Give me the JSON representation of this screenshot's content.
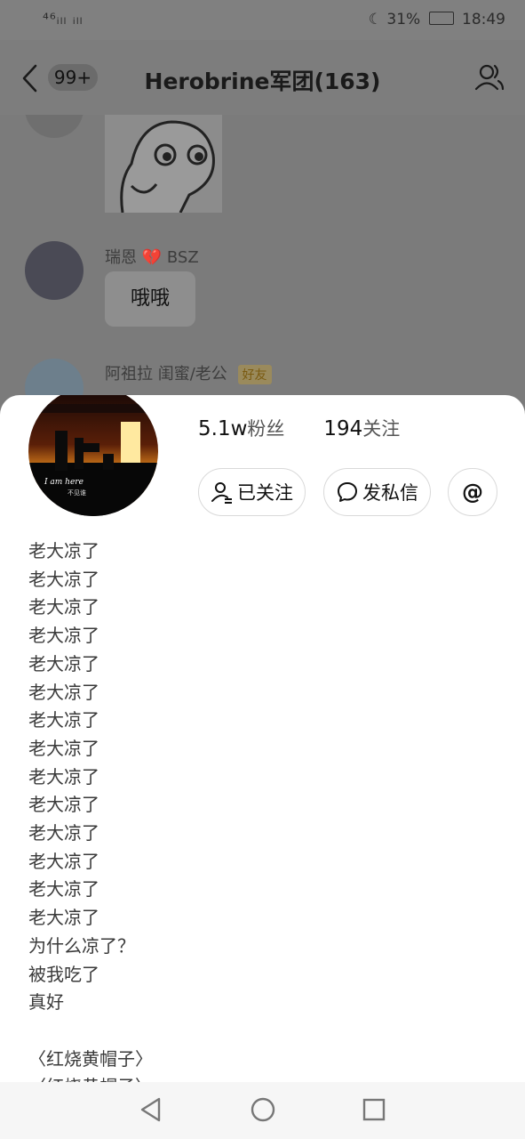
{
  "status_bar": {
    "left": "⁴⁶ᵢₗₗ ᵢₗₗ",
    "battery": "31%",
    "time": "18:49"
  },
  "header": {
    "unread_badge": "99+",
    "title": "Herobrine军团(163)"
  },
  "chat": {
    "messages": [
      {
        "sender": "瑞恩",
        "sender_tag": "BSZ",
        "text": "哦哦"
      },
      {
        "sender": "阿祖拉 闺蜜/老公",
        "badge": "好友"
      }
    ]
  },
  "profile": {
    "avatar_text_1": "I am here",
    "avatar_text_2": "不见谁",
    "fans_count": "5.1w",
    "fans_label": "粉丝",
    "following_count": "194",
    "following_label": "关注",
    "follow_button": "已关注",
    "message_button": "发私信",
    "mention_button": "@",
    "bio": "老大凉了\n老大凉了\n老大凉了\n老大凉了\n老大凉了\n老大凉了\n老大凉了\n老大凉了\n老大凉了\n老大凉了\n老大凉了\n老大凉了\n老大凉了\n老大凉了\n为什么凉了？\n被我吃了\n真好\n\n〈红烧黄帽子〉\n〈红烧黄帽子〉"
  },
  "colors": {
    "overlay": "#7d7d7d",
    "sheet": "#ffffff",
    "badge_tag": "#9a8a5c"
  }
}
